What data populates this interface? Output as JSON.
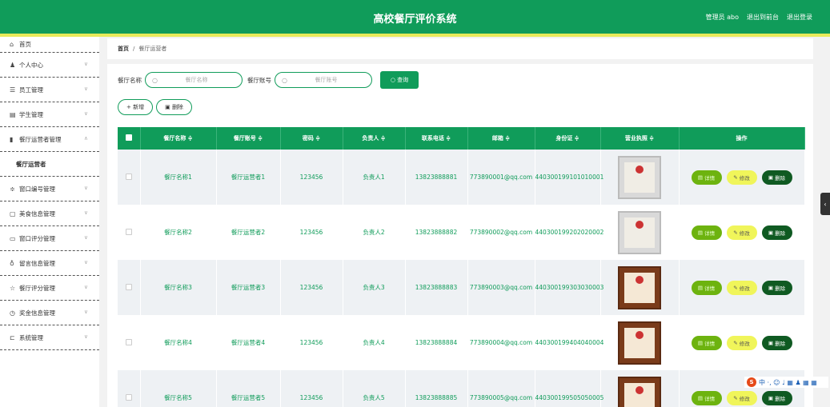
{
  "header": {
    "title": "高校餐厅评价系统",
    "admin": "管理员 abo",
    "back": "退出到前台",
    "logout": "退出登录"
  },
  "sidebar": {
    "items": [
      {
        "label": "首页",
        "icon": "home-icon",
        "glyph": "⌂",
        "chev": ""
      },
      {
        "label": "个人中心",
        "icon": "user-icon",
        "glyph": "♟",
        "chev": "∨"
      },
      {
        "label": "员工管理",
        "icon": "list-icon",
        "glyph": "☰",
        "chev": "∨"
      },
      {
        "label": "学生管理",
        "icon": "book-icon",
        "glyph": "▤",
        "chev": "∨"
      },
      {
        "label": "餐厅运营者管理",
        "icon": "chart-icon",
        "glyph": "▮",
        "chev": "∧"
      },
      {
        "label": "餐厅运营者",
        "icon": "",
        "glyph": "",
        "chev": "",
        "sub": true
      },
      {
        "label": "窗口编号管理",
        "icon": "sliders-icon",
        "glyph": "≑",
        "chev": "∨"
      },
      {
        "label": "美食信息管理",
        "icon": "square-icon",
        "glyph": "▢",
        "chev": "∨"
      },
      {
        "label": "窗口评分管理",
        "icon": "card-icon",
        "glyph": "▭",
        "chev": "∨"
      },
      {
        "label": "留言信息管理",
        "icon": "mic-icon",
        "glyph": "♁",
        "chev": "∨"
      },
      {
        "label": "餐厅评分管理",
        "icon": "star-icon",
        "glyph": "☆",
        "chev": "∨"
      },
      {
        "label": "奖金信息管理",
        "icon": "clock-icon",
        "glyph": "◷",
        "chev": "∨"
      },
      {
        "label": "系统管理",
        "icon": "monitor-icon",
        "glyph": "⊏",
        "chev": "∨"
      }
    ]
  },
  "breadcrumb": {
    "home": "首页",
    "sep": "/",
    "current": "餐厅运营者"
  },
  "search": {
    "label1": "餐厅名称",
    "placeholder1": "餐厅名称",
    "label2": "餐厅账号",
    "placeholder2": "餐厅账号",
    "button": "查询"
  },
  "actions": {
    "add": "+ 新增",
    "delete": "删除"
  },
  "table": {
    "columns": [
      "餐厅名称 ≑",
      "餐厅账号 ≑",
      "密码 ≑",
      "负责人 ≑",
      "联系电话 ≑",
      "邮箱 ≑",
      "身份证 ≑",
      "营业执照 ≑",
      "操作"
    ],
    "rows": [
      {
        "name": "餐厅名称1",
        "account": "餐厅运营者1",
        "pwd": "123456",
        "owner": "负责人1",
        "phone": "13823888881",
        "email": "773890001@qq.com",
        "idcard": "440300199101010001"
      },
      {
        "name": "餐厅名称2",
        "account": "餐厅运营者2",
        "pwd": "123456",
        "owner": "负责人2",
        "phone": "13823888882",
        "email": "773890002@qq.com",
        "idcard": "440300199202020002"
      },
      {
        "name": "餐厅名称3",
        "account": "餐厅运营者3",
        "pwd": "123456",
        "owner": "负责人3",
        "phone": "13823888883",
        "email": "773890003@qq.com",
        "idcard": "440300199303030003"
      },
      {
        "name": "餐厅名称4",
        "account": "餐厅运营者4",
        "pwd": "123456",
        "owner": "负责人4",
        "phone": "13823888884",
        "email": "773890004@qq.com",
        "idcard": "440300199404040004"
      },
      {
        "name": "餐厅名称5",
        "account": "餐厅运营者5",
        "pwd": "123456",
        "owner": "负责人5",
        "phone": "13823888885",
        "email": "773890005@qq.com",
        "idcard": "440300199505050005"
      }
    ],
    "ops": {
      "detail": "详情",
      "edit": "修改",
      "del": "删除"
    }
  },
  "ime": {
    "s": "S",
    "text": "中 ·, ☺ ♩ ▦ ♟ ▦ ▦"
  }
}
